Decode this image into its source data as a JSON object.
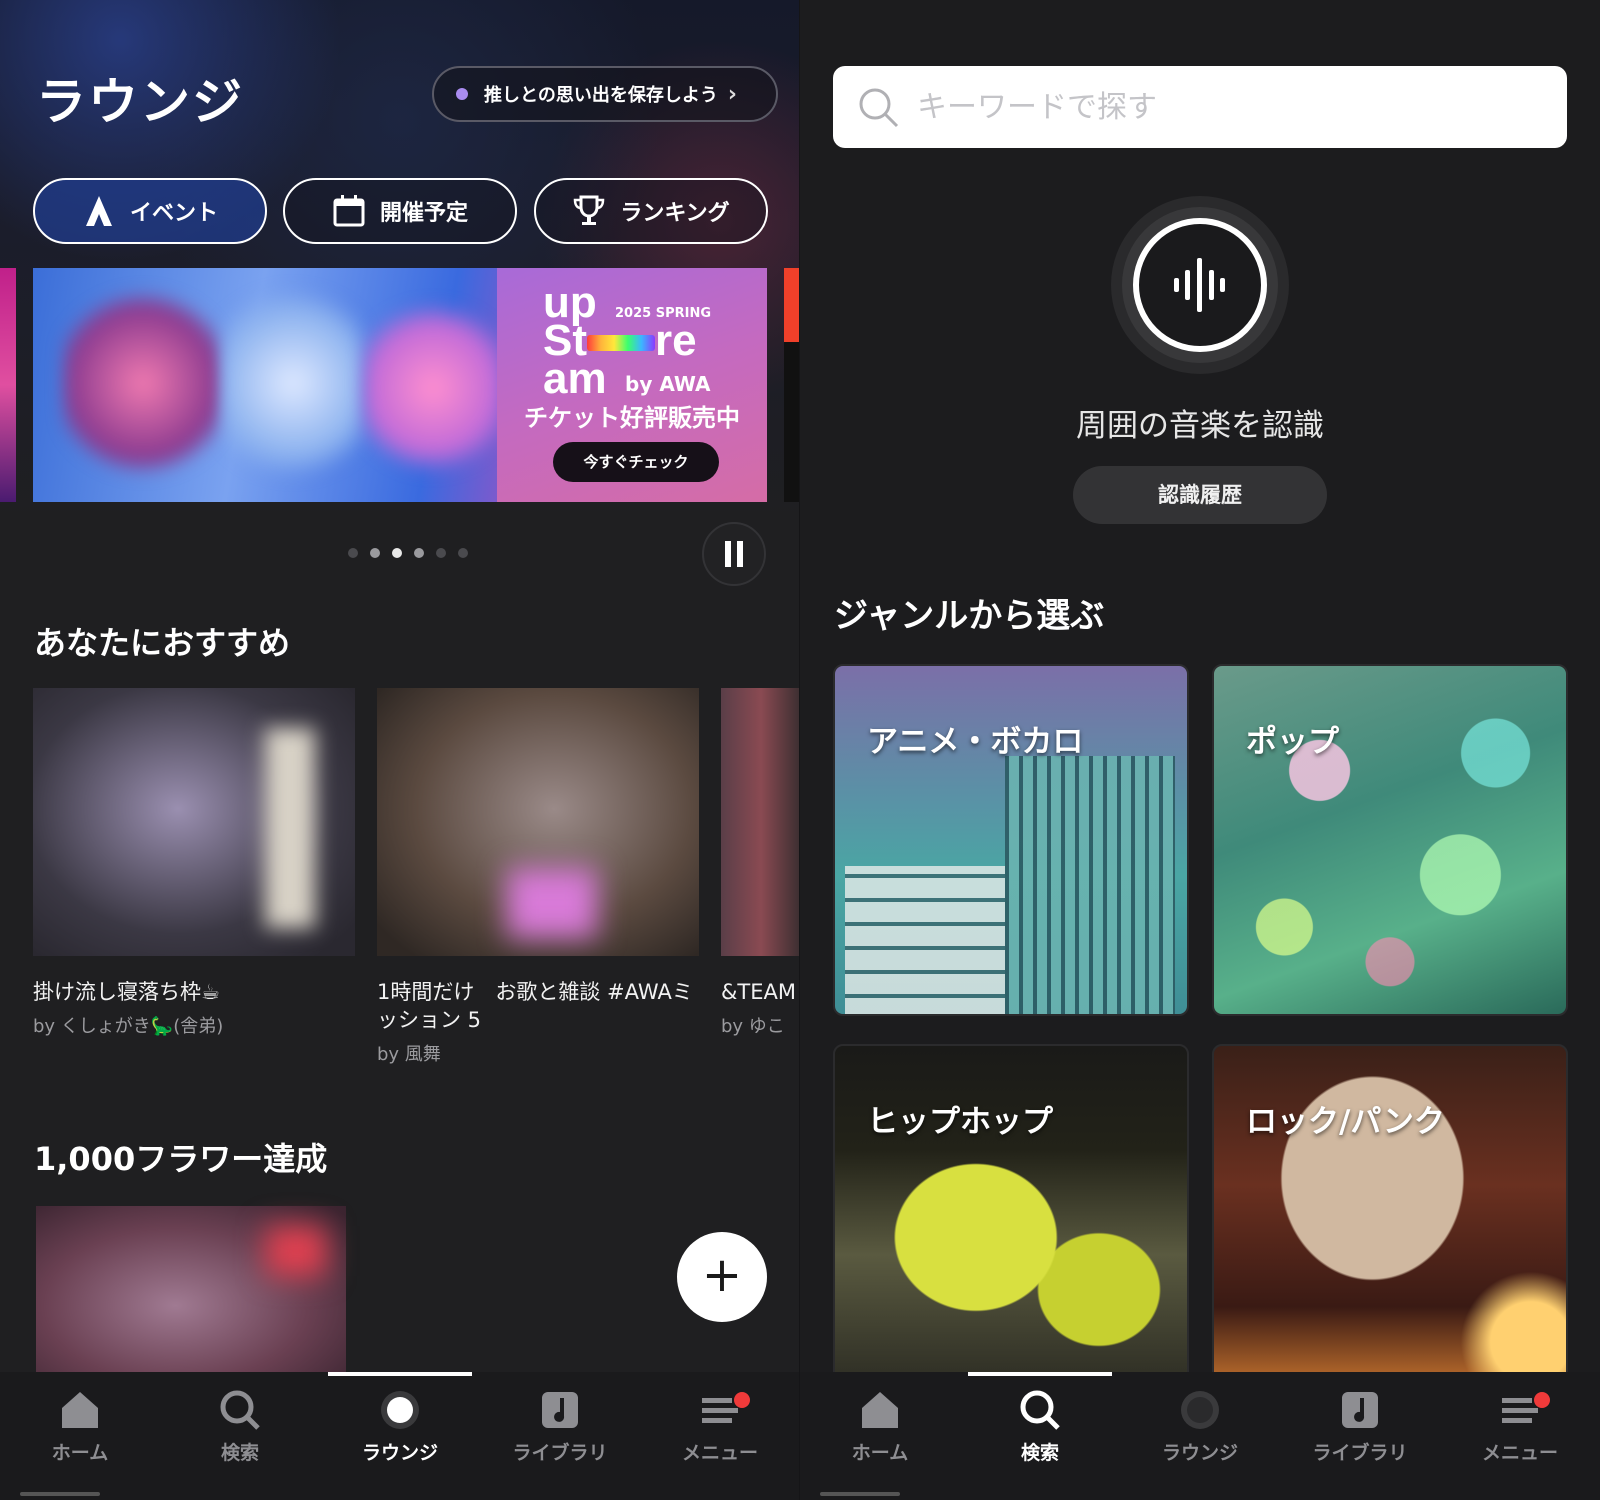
{
  "lounge": {
    "title": "ラウンジ",
    "memory_pill": "推しとの思い出を保存しよう",
    "categories": [
      {
        "label": "イベント",
        "icon": "tent-icon"
      },
      {
        "label": "開催予定",
        "icon": "calendar-icon"
      },
      {
        "label": "ランキング",
        "icon": "trophy-icon"
      }
    ],
    "banner": {
      "logo_line1": "up",
      "logo_line2_a": "St",
      "logo_line2_b": "re",
      "logo_line3": "am",
      "season": "2025 SPRING",
      "by": "by AWA",
      "ticket": "チケット好評販売中",
      "cta": "今すぐチェック"
    },
    "carousel": {
      "count": 6,
      "active_index": 2
    },
    "recommend": {
      "title": "あなたにおすすめ",
      "items": [
        {
          "title": "掛け流し寝落ち枠☕",
          "by": "by くしょがき🦕(舎弟)"
        },
        {
          "title": "1時間だけ　お歌と雑談 #AWAミッション 5",
          "by": "by 風舞"
        },
        {
          "title": "&TEAM",
          "by": "by ゆこ"
        }
      ]
    },
    "flower": {
      "title": "1,000フラワー達成"
    },
    "fab": "+"
  },
  "search": {
    "placeholder": "キーワードで探す",
    "recognize": "周囲の音楽を認識",
    "history": "認識履歴",
    "genre_title": "ジャンルから選ぶ",
    "genres": [
      "アニメ・ボカロ",
      "ポップ",
      "ヒップホップ",
      "ロック/パンク"
    ]
  },
  "tabs": [
    {
      "label": "ホーム",
      "icon": "home-icon"
    },
    {
      "label": "検索",
      "icon": "search-icon"
    },
    {
      "label": "ラウンジ",
      "icon": "lounge-icon"
    },
    {
      "label": "ライブラリ",
      "icon": "library-icon"
    },
    {
      "label": "メニュー",
      "icon": "menu-icon"
    }
  ],
  "colors": {
    "accent_active_tab": "#ffffff",
    "badge": "#f03a3a",
    "promo_bg": "#c46ac0"
  }
}
